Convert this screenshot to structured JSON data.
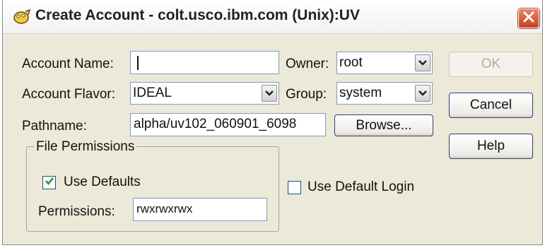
{
  "window": {
    "title": "Create Account - colt.usco.ibm.com (Unix):UV"
  },
  "form": {
    "account_name_label": "Account Name:",
    "account_name_value": "",
    "account_flavor_label": "Account Flavor:",
    "account_flavor_value": "IDEAL",
    "pathname_label": "Pathname:",
    "pathname_value": "alpha/uv102_060901_6098",
    "owner_label": "Owner:",
    "owner_value": "root",
    "group_label": "Group:",
    "group_value": "system"
  },
  "buttons": {
    "browse": "Browse...",
    "ok": "OK",
    "cancel": "Cancel",
    "help": "Help"
  },
  "file_permissions": {
    "title": "File Permissions",
    "use_defaults_label": "Use Defaults",
    "use_defaults_checked": true,
    "permissions_label": "Permissions:",
    "permissions_value": "rwxrwxrwx"
  },
  "use_default_login": {
    "label": "Use Default Login",
    "checked": false
  },
  "colors": {
    "dialog_bg": "#ECE9D8",
    "close_red": "#C3421F",
    "check_green": "#21A121",
    "field_border": "#7F9DB9"
  },
  "icons": {
    "title": "app-icon",
    "close": "close-icon",
    "dropdown": "chevron-down-icon",
    "check": "checkmark-icon"
  }
}
